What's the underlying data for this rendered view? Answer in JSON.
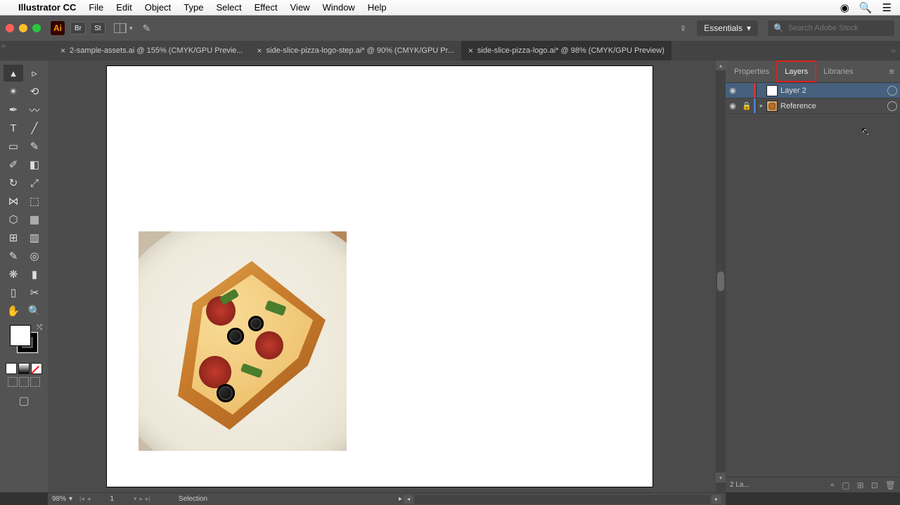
{
  "mac_menu": {
    "app": "Illustrator CC",
    "items": [
      "File",
      "Edit",
      "Object",
      "Type",
      "Select",
      "Effect",
      "View",
      "Window",
      "Help"
    ]
  },
  "topbar": {
    "workspace_label": "Essentials",
    "search_placeholder": "Search Adobe Stock"
  },
  "tabs": [
    {
      "label": "2-sample-assets.ai @ 155% (CMYK/GPU Previe...",
      "active": false
    },
    {
      "label": "side-slice-pizza-logo-step.ai* @ 90% (CMYK/GPU Pr...",
      "active": false
    },
    {
      "label": "side-slice-pizza-logo.ai* @ 98% (CMYK/GPU Preview)",
      "active": true
    }
  ],
  "panel": {
    "tabs": {
      "properties": "Properties",
      "layers": "Layers",
      "libraries": "Libraries"
    },
    "layers": [
      {
        "name": "Layer 2",
        "locked": false,
        "expandable": false,
        "thumb": "white",
        "selected": true
      },
      {
        "name": "Reference",
        "locked": true,
        "expandable": true,
        "thumb": "img",
        "selected": false
      }
    ],
    "footer_count": "2 La..."
  },
  "status": {
    "zoom": "98%",
    "artboard": "1",
    "tool": "Selection"
  }
}
